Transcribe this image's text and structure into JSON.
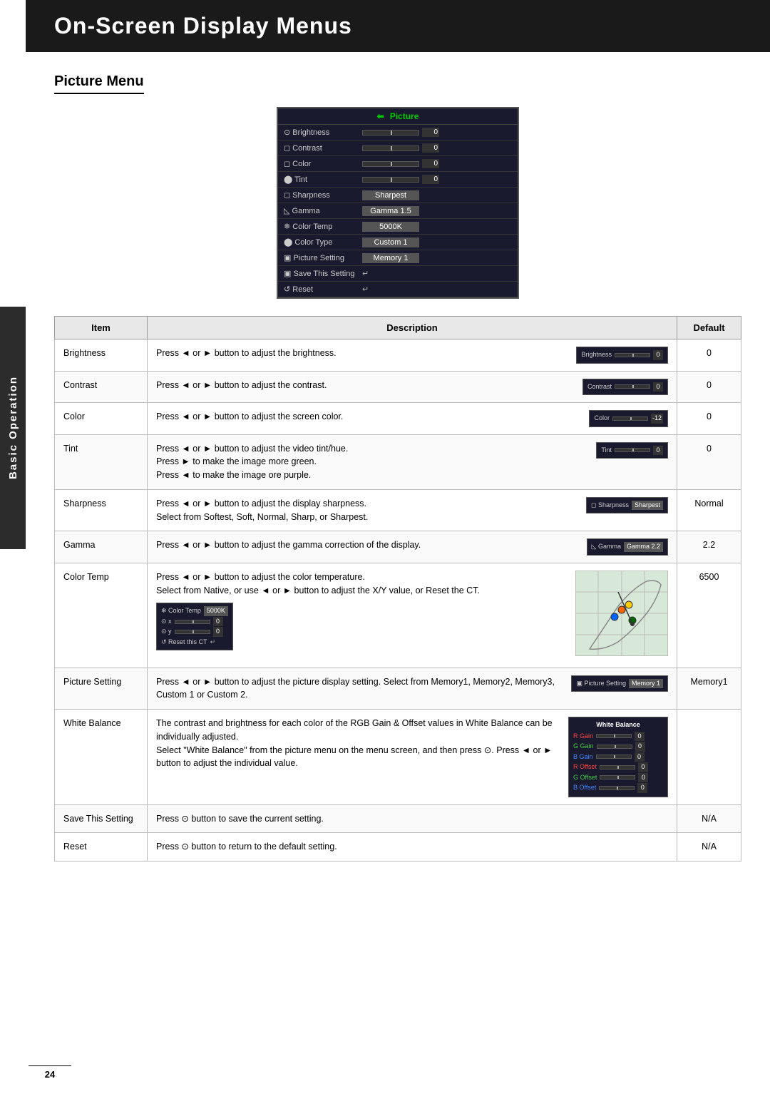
{
  "header": {
    "title": "On-Screen Display Menus"
  },
  "section": {
    "title": "Picture Menu"
  },
  "side_tab": {
    "label": "Basic Operation"
  },
  "osd_menu": {
    "title": "Picture",
    "rows": [
      {
        "label": "Brightness",
        "type": "bar",
        "value": "0"
      },
      {
        "label": "Contrast",
        "type": "bar",
        "value": "0"
      },
      {
        "label": "Color",
        "type": "bar",
        "value": "0"
      },
      {
        "label": "Tint",
        "type": "bar",
        "value": "0"
      },
      {
        "label": "Sharpness",
        "type": "text",
        "value": "Sharpest"
      },
      {
        "label": "Gamma",
        "type": "text",
        "value": "Gamma 1.5"
      },
      {
        "label": "Color Temp",
        "type": "text",
        "value": "5000K"
      },
      {
        "label": "Color Type",
        "type": "text",
        "value": "Custom 1"
      },
      {
        "label": "Picture Setting",
        "type": "text",
        "value": "Memory 1"
      },
      {
        "label": "Save This Setting",
        "type": "arrow"
      },
      {
        "label": "Reset",
        "type": "arrow"
      }
    ]
  },
  "table": {
    "headers": [
      "Item",
      "Description",
      "Default"
    ],
    "rows": [
      {
        "item": "Brightness",
        "description": "Press ◄ or ► button to adjust the brightness.",
        "default": "0",
        "has_mini": "brightness"
      },
      {
        "item": "Contrast",
        "description": "Press ◄ or ► button to adjust the contrast.",
        "default": "0",
        "has_mini": "contrast"
      },
      {
        "item": "Color",
        "description": "Press ◄ or ► button to adjust the screen color.",
        "default": "0",
        "has_mini": "color"
      },
      {
        "item": "Tint",
        "description": "Press ◄ or ► button to adjust the video tint/hue.\nPress ► to make the image more green.\nPress ◄ to make the image ore purple.",
        "default": "0",
        "has_mini": "tint"
      },
      {
        "item": "Sharpness",
        "description": "Press ◄ or ► button to adjust the display sharpness.\nSelect from Softest, Soft, Normal, Sharp, or Sharpest.",
        "default": "Normal",
        "has_mini": "sharpness"
      },
      {
        "item": "Gamma",
        "description": "Press ◄ or ► button to adjust the gamma correction of the display.",
        "default": "2.2",
        "has_mini": "gamma"
      },
      {
        "item": "Color Temp",
        "description": "Press ◄ or ► button to adjust the color temperature.\nSelect from Native, or use ◄ or ► button to adjust the X/Y value, or Reset the CT.",
        "default": "6500",
        "has_mini": "colortemp"
      },
      {
        "item": "Picture Setting",
        "description": "Press ◄ or ► button to adjust the picture display setting. Select from Memory1, Memory2, Memory3, Custom 1 or Custom 2.",
        "default": "Memory1",
        "has_mini": "picturesetting"
      },
      {
        "item": "White Balance",
        "description": "The contrast and brightness for each color of the RGB Gain & Offset values in White Balance can be individually adjusted.\nSelect \"White Balance\" from the picture menu on the menu screen, and then press ⊙. Press ◄ or ► button to adjust the individual value.",
        "default": "",
        "has_mini": "whitebalance"
      },
      {
        "item": "Save This Setting",
        "description": "Press ⊙ button to save the current setting.",
        "default": "N/A",
        "has_mini": ""
      },
      {
        "item": "Reset",
        "description": "Press ⊙ button to return to the default setting.",
        "default": "N/A",
        "has_mini": ""
      }
    ]
  },
  "footer": {
    "page": "24"
  }
}
